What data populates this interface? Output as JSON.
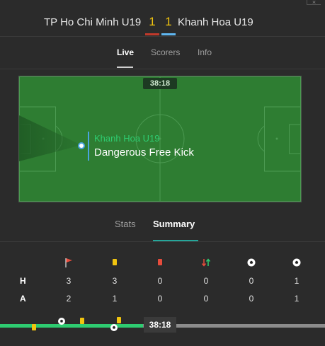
{
  "match": {
    "home_team": "TP Ho Chi Minh U19",
    "away_team": "Khanh Hoa U19",
    "home_score": "1",
    "away_score": "1"
  },
  "tabs": [
    {
      "label": "Live",
      "active": true
    },
    {
      "label": "Scorers",
      "active": false
    },
    {
      "label": "Info",
      "active": false
    }
  ],
  "pitch": {
    "clock": "38:18",
    "event_team": "Khanh Hoa U19",
    "event_title": "Dangerous Free Kick"
  },
  "subtabs": [
    {
      "label": "Stats",
      "active": false
    },
    {
      "label": "Summary",
      "active": true
    }
  ],
  "stats": {
    "columns": [
      "corners-flag-icon",
      "yellow-card-icon",
      "red-card-icon",
      "substitution-icon",
      "goal-ball-icon",
      "penalty-ball-icon"
    ],
    "rows": [
      {
        "label": "H",
        "values": [
          "3",
          "3",
          "0",
          "0",
          "0",
          "1"
        ]
      },
      {
        "label": "A",
        "values": [
          "2",
          "1",
          "0",
          "0",
          "0",
          "1"
        ]
      }
    ]
  },
  "timeline": {
    "clock": "38:18",
    "progress": 0.44
  },
  "colors": {
    "home": "#c0392b",
    "away": "#5fb6f0",
    "pitch": "#2e7d32",
    "accent": "#26a69a",
    "score": "#f1c40f"
  }
}
